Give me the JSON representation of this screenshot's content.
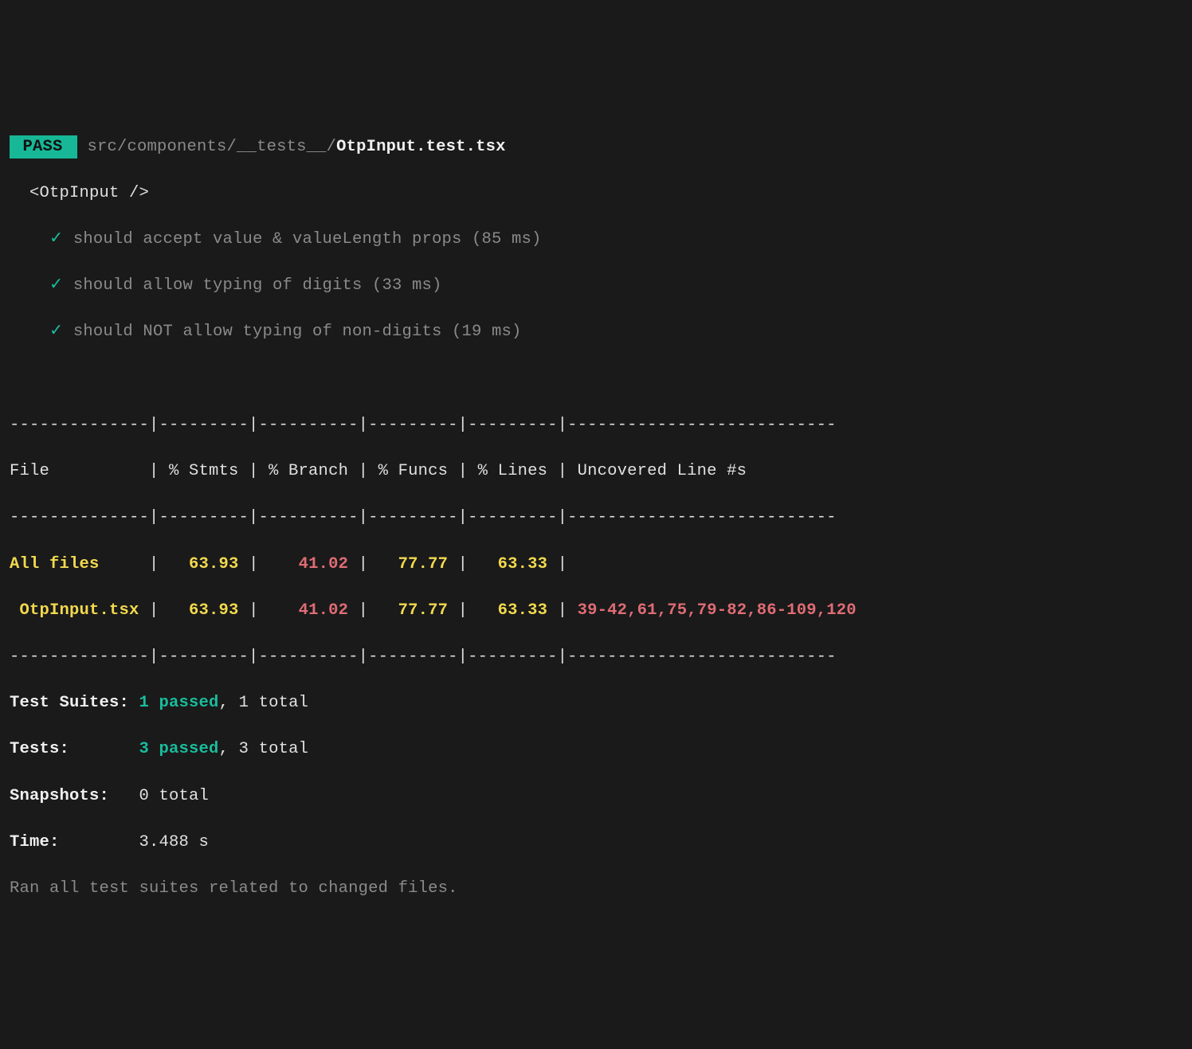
{
  "header": {
    "pass_badge": " PASS ",
    "path_dim": "src/components/__tests__/",
    "path_file": "OtpInput.test.tsx"
  },
  "describe": {
    "name": "<OtpInput />",
    "tests": [
      {
        "check": "✓",
        "desc": "should accept value & valueLength props (85 ms)"
      },
      {
        "check": "✓",
        "desc": "should allow typing of digits (33 ms)"
      },
      {
        "check": "✓",
        "desc": "should NOT allow typing of non-digits (19 ms)"
      }
    ]
  },
  "coverage": {
    "border_top": "--------------|---------|----------|---------|---------|---------------------------",
    "header_row": "File          | % Stmts | % Branch | % Funcs | % Lines | Uncovered Line #s         ",
    "border_mid": "--------------|---------|----------|---------|---------|---------------------------",
    "rows": [
      {
        "file": "All files    ",
        "stmts": "63.93",
        "branch": "41.02",
        "funcs": "77.77",
        "lines": "63.33",
        "uncovered": "                         "
      },
      {
        "file": " OtpInput.tsx",
        "stmts": "63.93",
        "branch": "41.02",
        "funcs": "77.77",
        "lines": "63.33",
        "uncovered": "39-42,61,75,79-82,86-109,120"
      }
    ],
    "border_bot": "--------------|---------|----------|---------|---------|---------------------------"
  },
  "summary": {
    "test_suites_label": "Test Suites: ",
    "test_suites_passed": "1 passed",
    "test_suites_total": ", 1 total",
    "tests_label": "Tests:       ",
    "tests_passed": "3 passed",
    "tests_total": ", 3 total",
    "snapshots_label": "Snapshots:   ",
    "snapshots_value": "0 total",
    "time_label": "Time:        ",
    "time_value": "3.488 s",
    "footer": "Ran all test suites related to changed files."
  }
}
